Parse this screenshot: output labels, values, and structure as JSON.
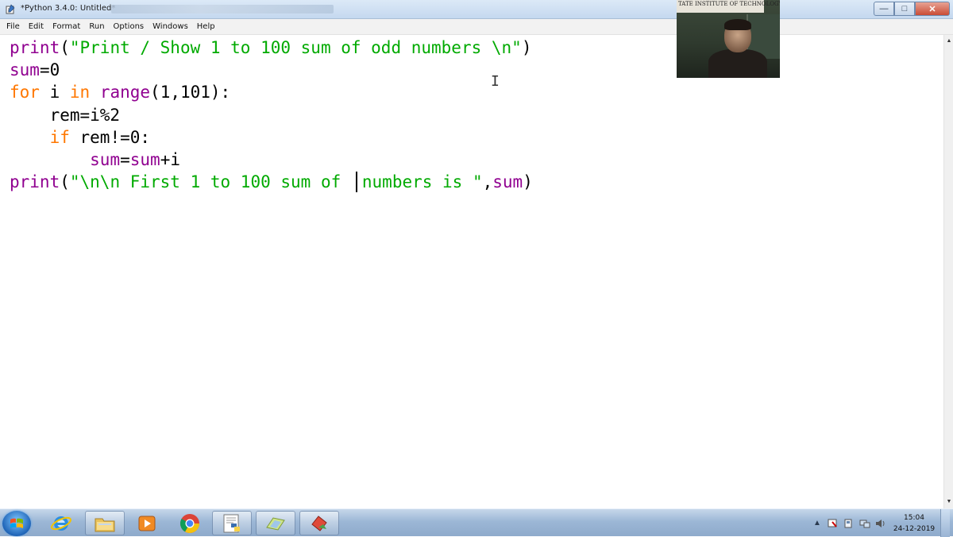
{
  "window": {
    "title": "*Python 3.4.0: Untitled*",
    "buttons": {
      "minimize": "—",
      "maximize": "□",
      "close": "✕"
    }
  },
  "menubar": {
    "items": [
      "File",
      "Edit",
      "Format",
      "Run",
      "Options",
      "Windows",
      "Help"
    ]
  },
  "editor": {
    "lines": [
      {
        "segments": [
          {
            "t": "print",
            "c": "bi"
          },
          {
            "t": "(",
            "c": ""
          },
          {
            "t": "\"Print / Show 1 to 100 sum of odd numbers \\n\"",
            "c": "str"
          },
          {
            "t": ")",
            "c": ""
          }
        ]
      },
      {
        "segments": [
          {
            "t": "sum",
            "c": "bi"
          },
          {
            "t": "=0",
            "c": ""
          }
        ]
      },
      {
        "segments": [
          {
            "t": "for",
            "c": "kw"
          },
          {
            "t": " i ",
            "c": ""
          },
          {
            "t": "in",
            "c": "kw"
          },
          {
            "t": " ",
            "c": ""
          },
          {
            "t": "range",
            "c": "bi"
          },
          {
            "t": "(1,101):",
            "c": ""
          }
        ]
      },
      {
        "segments": [
          {
            "t": "    rem=i%2",
            "c": ""
          }
        ]
      },
      {
        "segments": [
          {
            "t": "    ",
            "c": ""
          },
          {
            "t": "if",
            "c": "kw"
          },
          {
            "t": " rem!=0:",
            "c": ""
          }
        ]
      },
      {
        "segments": [
          {
            "t": "        ",
            "c": ""
          },
          {
            "t": "sum",
            "c": "bi"
          },
          {
            "t": "=",
            "c": ""
          },
          {
            "t": "sum",
            "c": "bi"
          },
          {
            "t": "+i",
            "c": ""
          }
        ]
      },
      {
        "segments": [
          {
            "t": "print",
            "c": "bi"
          },
          {
            "t": "(",
            "c": ""
          },
          {
            "t": "\"\\n\\n First 1 to 100 sum of ",
            "c": "str"
          },
          {
            "t": "|CARET|",
            "c": "caret"
          },
          {
            "t": "numbers is \"",
            "c": "str"
          },
          {
            "t": ",",
            "c": ""
          },
          {
            "t": "sum",
            "c": "bi"
          },
          {
            "t": ")",
            "c": ""
          }
        ]
      }
    ]
  },
  "webcam": {
    "sign_text": "TATE INSTITUTE OF TECHNOLOGY"
  },
  "taskbar": {
    "apps": [
      {
        "name": "internet-explorer",
        "icon": "ie-icon"
      },
      {
        "name": "file-explorer",
        "icon": "folder-icon"
      },
      {
        "name": "media-player",
        "icon": "play-icon"
      },
      {
        "name": "chrome",
        "icon": "chrome-icon"
      },
      {
        "name": "python-idle",
        "icon": "python-icon"
      },
      {
        "name": "app-green",
        "icon": "app-icon"
      },
      {
        "name": "app-red",
        "icon": "app-icon"
      }
    ],
    "clock": {
      "time": "15:04",
      "date": "24-12-2019"
    }
  }
}
